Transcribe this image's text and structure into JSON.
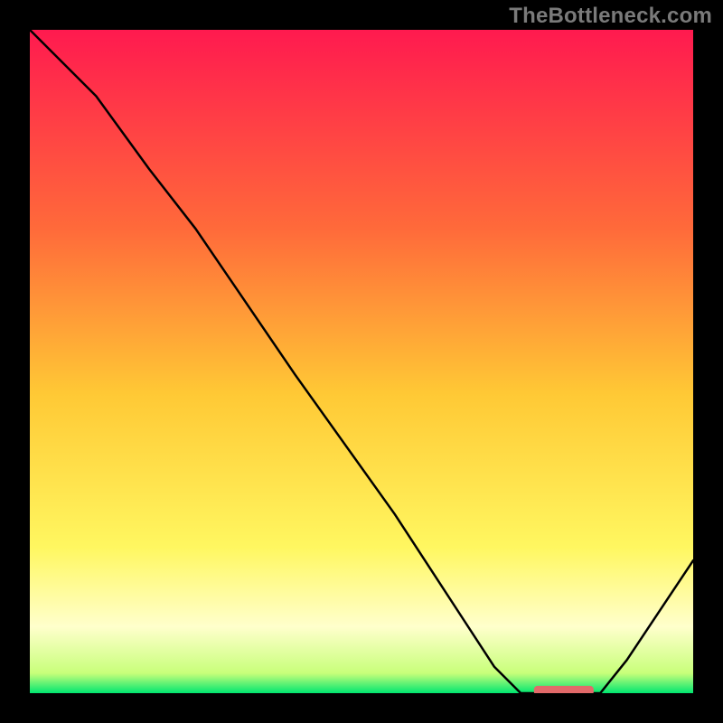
{
  "watermark": "TheBottleneck.com",
  "chart_data": {
    "type": "line",
    "title": "",
    "xlabel": "",
    "ylabel": "",
    "xlim": [
      0,
      100
    ],
    "ylim": [
      0,
      100
    ],
    "grid": false,
    "background": "heatmap-vertical",
    "background_stops": [
      {
        "pos": 0.0,
        "color": "#ff1a4f"
      },
      {
        "pos": 0.3,
        "color": "#ff6a3a"
      },
      {
        "pos": 0.55,
        "color": "#ffc935"
      },
      {
        "pos": 0.78,
        "color": "#fff760"
      },
      {
        "pos": 0.9,
        "color": "#ffffcc"
      },
      {
        "pos": 0.97,
        "color": "#c8ff7a"
      },
      {
        "pos": 1.0,
        "color": "#00e670"
      }
    ],
    "series": [
      {
        "name": "curve",
        "color": "#000000",
        "stroke_width": 2.5,
        "x": [
          0,
          10,
          18,
          25,
          40,
          55,
          70,
          74,
          80,
          86,
          90,
          100
        ],
        "y": [
          100,
          90,
          79,
          70,
          48,
          27,
          4,
          0,
          0,
          0,
          5,
          20
        ]
      }
    ],
    "marker": {
      "name": "highlight-bar",
      "color": "#e26a6a",
      "x_start": 76,
      "x_end": 85,
      "y": 0.4,
      "thickness": 1.4
    }
  }
}
